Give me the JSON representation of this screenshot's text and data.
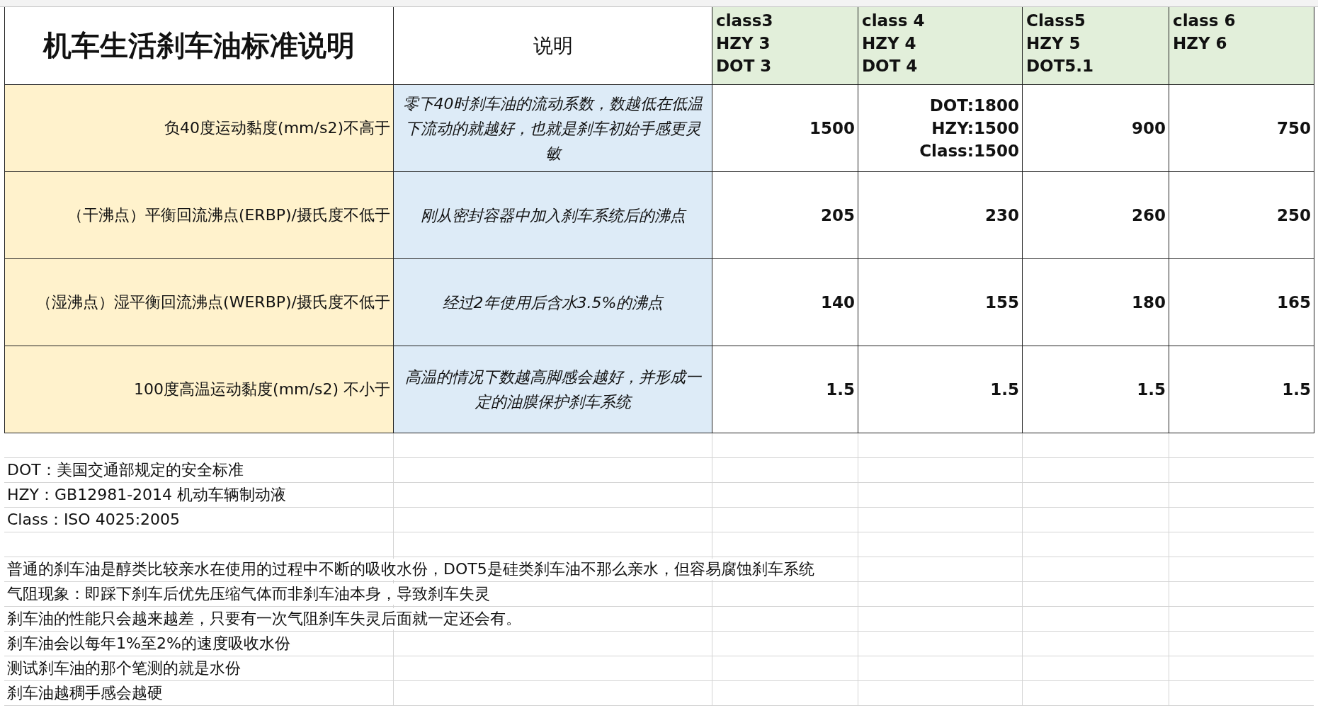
{
  "title": "机车生活刹车油标准说明",
  "description_header": "说明",
  "grades": [
    {
      "lines": [
        "class3",
        "HZY 3",
        "DOT 3"
      ]
    },
    {
      "lines": [
        "class 4",
        "HZY 4",
        "DOT 4"
      ]
    },
    {
      "lines": [
        "Class5",
        "HZY 5",
        "DOT5.1"
      ]
    },
    {
      "lines": [
        "class 6",
        "HZY 6"
      ]
    }
  ],
  "rows": [
    {
      "label": "负40度运动黏度(mm/s2)不高于",
      "description": "零下40时刹车油的流动系数，数越低在低温下流动的就越好，也就是刹车初始手感更灵敏",
      "values": [
        [
          "1500"
        ],
        [
          "DOT:1800",
          "HZY:1500",
          "Class:1500"
        ],
        [
          "900"
        ],
        [
          "750"
        ]
      ]
    },
    {
      "label": "（干沸点）平衡回流沸点(ERBP)/摄氏度不低于",
      "description": "刚从密封容器中加入刹车系统后的沸点",
      "values": [
        [
          "205"
        ],
        [
          "230"
        ],
        [
          "260"
        ],
        [
          "250"
        ]
      ]
    },
    {
      "label": "（湿沸点）湿平衡回流沸点(WERBP)/摄氏度不低于",
      "description": "经过2年使用后含水3.5%的沸点",
      "values": [
        [
          "140"
        ],
        [
          "155"
        ],
        [
          "180"
        ],
        [
          "165"
        ]
      ]
    },
    {
      "label": "100度高温运动黏度(mm/s2) 不小于",
      "description": "高温的情况下数越高脚感会越好，并形成一定的油膜保护刹车系统",
      "values": [
        [
          "1.5"
        ],
        [
          "1.5"
        ],
        [
          "1.5"
        ],
        [
          "1.5"
        ]
      ]
    }
  ],
  "legend": [
    "DOT：美国交通部规定的安全标准",
    "HZY：GB12981-2014 机动车辆制动液",
    "Class：ISO 4025:2005"
  ],
  "remarks": [
    "普通的刹车油是醇类比较亲水在使用的过程中不断的吸收水份，DOT5是硅类刹车油不那么亲水，但容易腐蚀刹车系统",
    "气阻现象：即踩下刹车后优先压缩气体而非刹车油本身，导致刹车失灵",
    "刹车油的性能只会越来越差，只要有一次气阻刹车失灵后面就一定还会有。",
    "刹车油会以每年1%至2%的速度吸收水份",
    "测试刹车油的那个笔测的就是水份",
    "刹车油越稠手感会越硬"
  ]
}
